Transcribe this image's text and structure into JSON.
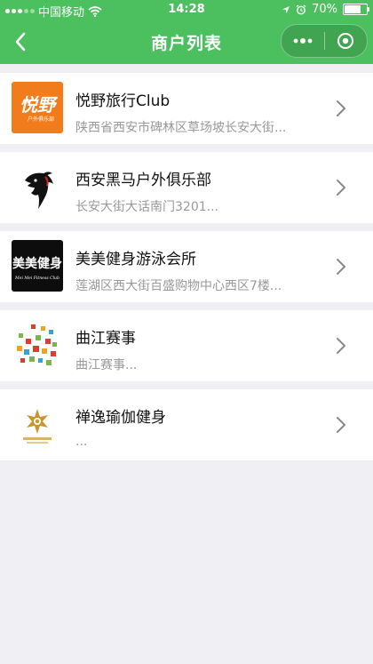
{
  "statusbar": {
    "carrier": "中国移动",
    "time": "14:28",
    "battery": "70%"
  },
  "navbar": {
    "title": "商户列表",
    "back_icon": "chevron-left-icon",
    "more_icon": "more-dots-icon",
    "close_icon": "target-close-icon"
  },
  "colors": {
    "header_bg": "#4cbf5f",
    "page_bg": "#efeff4",
    "name_text": "#111111",
    "address_text": "#999999"
  },
  "merchants": [
    {
      "name": "悦野旅行Club",
      "address": "陕西省西安市碑林区草场坡长安大街...",
      "logo_text": "悦野",
      "logo_subtext": "户外俱乐部"
    },
    {
      "name": "西安黑马户外俱乐部",
      "address": "长安大街大话南门3201...",
      "logo_icon": "horse-icon"
    },
    {
      "name": "美美健身游泳会所",
      "address": "莲湖区西大街百盛购物中心西区7楼...",
      "logo_text": "美美健身",
      "logo_subtext": "Mei Mei Fitness Club"
    },
    {
      "name": "曲江赛事",
      "address": "曲江赛事...",
      "logo_icon": "mosaic-logo-icon"
    },
    {
      "name": "禅逸瑜伽健身",
      "address": "...",
      "logo_icon": "lotus-logo-icon"
    }
  ]
}
